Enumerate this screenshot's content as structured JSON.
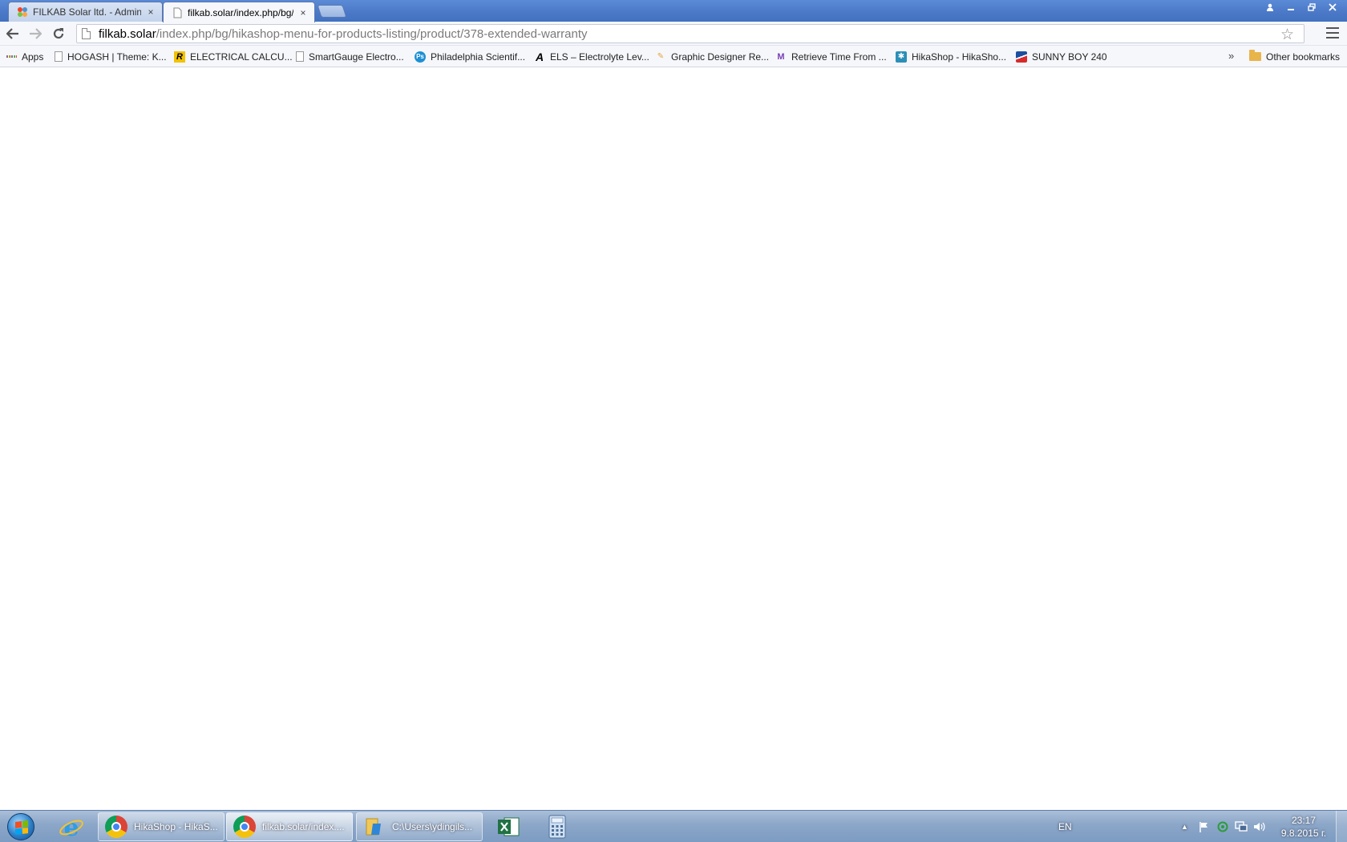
{
  "browser": {
    "tabs": [
      {
        "title": "FILKAB Solar ltd. - Admini",
        "active": false,
        "close": "×"
      },
      {
        "title": "filkab.solar/index.php/bg/",
        "active": true,
        "close": "×"
      }
    ],
    "omnibox": {
      "host": "filkab.solar",
      "path": "/index.php/bg/hikashop-menu-for-products-listing/product/378-extended-warranty"
    },
    "bookmarks": [
      {
        "label": "Apps",
        "icon": "apps-grid-icon"
      },
      {
        "label": "HOGASH | Theme: K...",
        "icon": "page-icon"
      },
      {
        "label": "ELECTRICAL CALCU...",
        "icon": "r-logo-icon"
      },
      {
        "label": "SmartGauge Electro...",
        "icon": "page-icon"
      },
      {
        "label": "Philadelphia Scientif...",
        "icon": "ps-logo-icon"
      },
      {
        "label": "ELS – Electrolyte Lev...",
        "icon": "a-logo-icon"
      },
      {
        "label": "Graphic Designer Re...",
        "icon": "designer-icon"
      },
      {
        "label": "Retrieve Time From ...",
        "icon": "m-logo-icon"
      },
      {
        "label": "HikaShop - HikaSho...",
        "icon": "hikashop-icon"
      },
      {
        "label": "SUNNY BOY 240",
        "icon": "sma-logo-icon"
      }
    ],
    "overflow": "»",
    "other_bookmarks": "Other bookmarks"
  },
  "taskbar": {
    "tasks": [
      {
        "label": "HikaShop - HikaS...",
        "icon": "chrome-icon"
      },
      {
        "label": "filkab.solar/index....",
        "icon": "chrome-icon"
      },
      {
        "label": "C:\\Users\\ydingils...",
        "icon": "folder-icon"
      }
    ],
    "tray": {
      "language": "EN",
      "arrow": "▲",
      "time": "23:17",
      "date": "9.8.2015 г."
    }
  },
  "colors": {
    "titlebar": "#4a78c7",
    "toolbar": "#f5f7fb",
    "taskbar": "#8ba6c8",
    "page_background": "#ffffff"
  }
}
